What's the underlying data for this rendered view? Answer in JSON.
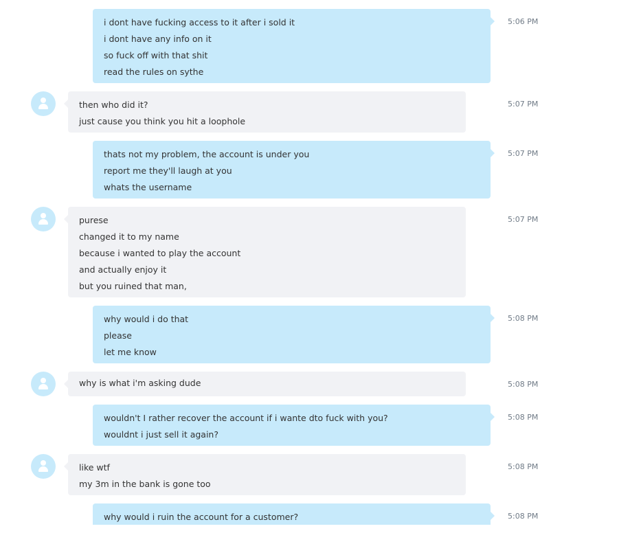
{
  "colors": {
    "outgoing_bubble": "#c7eafb",
    "incoming_bubble": "#f1f2f5",
    "avatar_bg": "#c7eafb",
    "timestamp_text": "#6f7a86",
    "message_text": "#333333"
  },
  "avatar_icon": "user-silhouette-icon",
  "messages": [
    {
      "direction": "outgoing",
      "time": "5:06 PM",
      "lines": [
        "i dont have fucking access to it after i sold it",
        "i dont have any info on it",
        "so fuck off with that shit",
        "read the rules on sythe"
      ]
    },
    {
      "direction": "incoming",
      "time": "5:07 PM",
      "lines": [
        "then who did it?",
        "just cause you think you hit a loophole"
      ]
    },
    {
      "direction": "outgoing",
      "time": "5:07 PM",
      "lines": [
        "thats not my problem, the account is under you",
        "report me they'll laugh at you",
        "whats the username"
      ]
    },
    {
      "direction": "incoming",
      "time": "5:07 PM",
      "lines": [
        "purese",
        "changed it to my name",
        "because i wanted to play the account",
        "and actually enjoy it",
        "but you ruined that man,"
      ]
    },
    {
      "direction": "outgoing",
      "time": "5:08 PM",
      "lines": [
        "why would i do that",
        "please",
        "let me know"
      ]
    },
    {
      "direction": "incoming",
      "time": "5:08 PM",
      "lines": [
        "why is what i'm asking dude"
      ]
    },
    {
      "direction": "outgoing",
      "time": "5:08 PM",
      "lines": [
        "wouldn't I rather recover the account if i wante dto fuck with you?",
        "wouldnt i just sell it again?"
      ]
    },
    {
      "direction": "incoming",
      "time": "5:08 PM",
      "lines": [
        "like wtf",
        "my 3m in the bank is gone too"
      ]
    },
    {
      "direction": "outgoing",
      "time": "5:08 PM",
      "lines": [
        "why would i ruin the account for a customer?"
      ]
    }
  ]
}
